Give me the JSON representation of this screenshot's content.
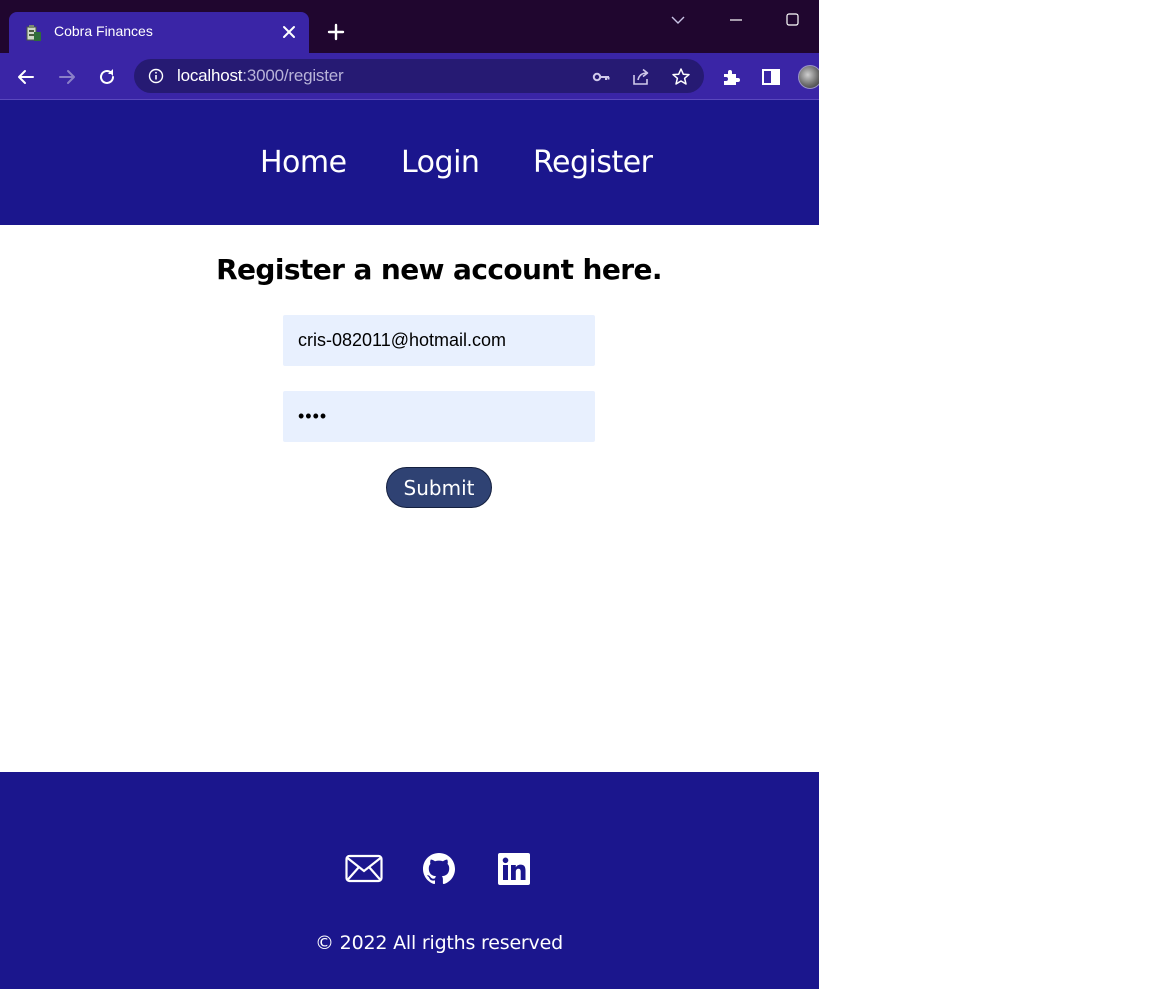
{
  "browser": {
    "tab_title": "Cobra Finances",
    "url_host": "localhost",
    "url_rest": ":3000/register"
  },
  "nav": {
    "items": [
      {
        "label": "Home"
      },
      {
        "label": "Login"
      },
      {
        "label": "Register"
      }
    ]
  },
  "form": {
    "heading": "Register a new account here.",
    "email_value": "cris-082011@hotmail.com",
    "password_value": "••••",
    "submit_label": "Submit"
  },
  "footer": {
    "social": [
      "mail-icon",
      "github-icon",
      "linkedin-icon"
    ],
    "copyright": "© 2022 All rigths reserved"
  },
  "colors": {
    "tab_strip": "#20062f",
    "toolbar": "#3a25a6",
    "site_primary": "#1b168d",
    "input_bg": "#e8f0fe",
    "submit_bg": "#2f4273"
  }
}
